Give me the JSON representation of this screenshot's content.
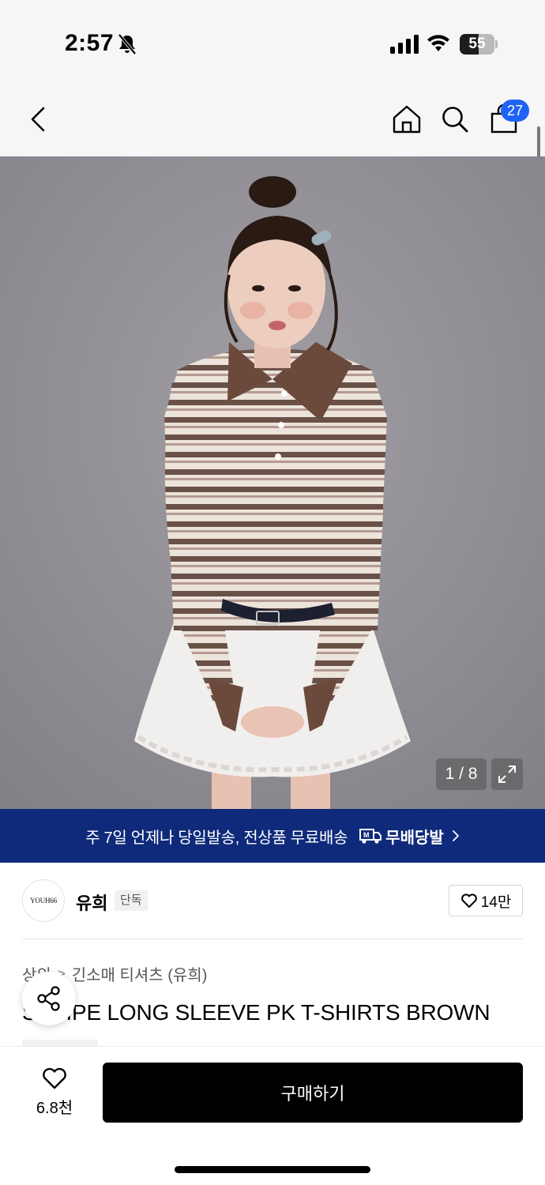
{
  "status_bar": {
    "time": "2:57",
    "battery": "55",
    "battery_level": 0.55,
    "icons": [
      "bell-muted-icon",
      "cellular-signal-icon",
      "wifi-icon",
      "battery-icon"
    ]
  },
  "nav": {
    "icons": [
      "back-chevron-icon",
      "home-icon",
      "search-icon",
      "shopping-bag-icon"
    ],
    "cart_count": "27"
  },
  "gallery": {
    "counter": "1 / 8",
    "thumbnail_icons": [
      "thumbnail-image",
      "chevron-right-icon"
    ],
    "expand_icon": "expand-arrows-icon",
    "colors": {
      "background": "#8c8a8f",
      "stripe_dark": "#6a5148",
      "stripe_light": "#e6dcd3",
      "collar": "#6b4a3c"
    }
  },
  "banner": {
    "text": "주 7일 언제나 당일발송, 전상품 무료배송",
    "logo": "무배당발",
    "background": "#0f2a7a",
    "icons": [
      "delivery-truck-icon",
      "chevron-right-icon"
    ]
  },
  "brand": {
    "logo_text": "YOUH66",
    "name": "유희",
    "badge": "단독",
    "like_count": "14만",
    "like_icon": "heart-outline-icon"
  },
  "product": {
    "breadcrumb": [
      "상의",
      "긴소매 티셔츠 (유희)"
    ],
    "title": "STRIPE LONG SLEEVE PK T-SHIRTS BROWN"
  },
  "share": {
    "icon": "share-icon"
  },
  "bottom_bar": {
    "wish_count": "6.8천",
    "wish_icon": "heart-outline-icon",
    "buy_label": "구매하기",
    "buy_color": "#000000"
  }
}
